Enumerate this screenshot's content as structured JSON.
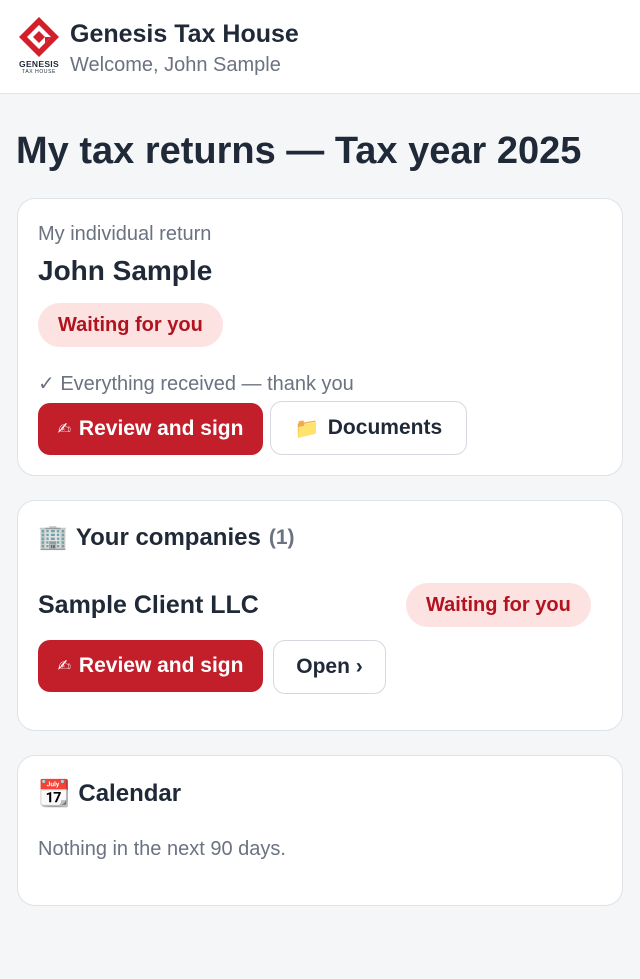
{
  "header": {
    "brand_name": "Genesis Tax House",
    "welcome": "Welcome, John Sample",
    "logo_word": "GENESIS",
    "logo_sub": "TAX HOUSE",
    "logo_icon": "genesis-diamond-logo"
  },
  "page": {
    "title": "My tax returns — Tax year 2025"
  },
  "individual": {
    "label": "My individual return",
    "name": "John Sample",
    "status": "Waiting for you",
    "received_note": "✓ Everything received — thank you",
    "review_button_icon": "✍",
    "review_button": "Review and sign",
    "documents_button_icon": "📁",
    "documents_button": "Documents"
  },
  "companies": {
    "icon": "🏢",
    "title": "Your companies",
    "count": "(1)",
    "items": [
      {
        "name": "Sample Client LLC",
        "status": "Waiting for you",
        "review_button_icon": "✍",
        "review_button": "Review and sign",
        "open_button": "Open ›"
      }
    ]
  },
  "calendar": {
    "icon": "📆",
    "title": "Calendar",
    "empty_text": "Nothing in the next 90 days."
  },
  "colors": {
    "accent": "#c21f2b",
    "badge_bg": "#fde2e2",
    "badge_text": "#b1131f",
    "text_primary": "#1f2937",
    "text_muted": "#6b7280"
  }
}
